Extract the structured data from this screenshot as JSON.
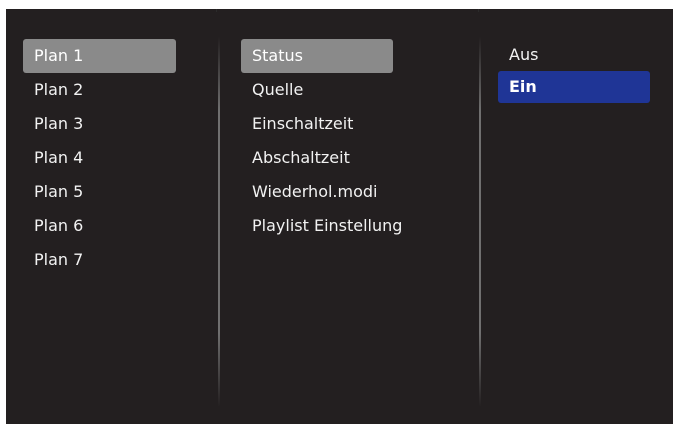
{
  "plans": {
    "items": [
      {
        "label": "Plan 1",
        "selected": true
      },
      {
        "label": "Plan 2",
        "selected": false
      },
      {
        "label": "Plan 3",
        "selected": false
      },
      {
        "label": "Plan 4",
        "selected": false
      },
      {
        "label": "Plan 5",
        "selected": false
      },
      {
        "label": "Plan 6",
        "selected": false
      },
      {
        "label": "Plan 7",
        "selected": false
      }
    ]
  },
  "settings": {
    "items": [
      {
        "label": "Status",
        "selected": true
      },
      {
        "label": "Quelle",
        "selected": false
      },
      {
        "label": "Einschaltzeit",
        "selected": false
      },
      {
        "label": "Abschaltzeit",
        "selected": false
      },
      {
        "label": "Wiederhol.modi",
        "selected": false
      },
      {
        "label": "Playlist Einstellung",
        "selected": false
      }
    ]
  },
  "options": {
    "items": [
      {
        "label": "Aus",
        "selected": false
      },
      {
        "label": "Ein",
        "selected": true
      }
    ]
  },
  "colors": {
    "background": "#231f20",
    "focus_grey": "#8a8a8a",
    "focus_blue": "#1f3596",
    "text": "#f2f2f2"
  }
}
